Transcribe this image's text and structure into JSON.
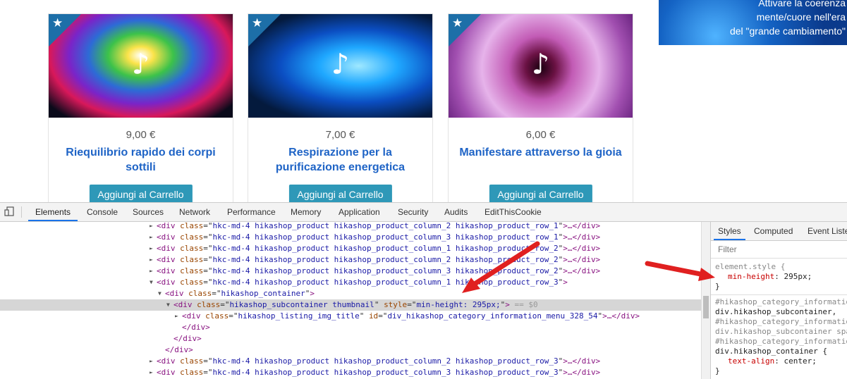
{
  "products": [
    {
      "price": "9,00 €",
      "title": "Riequilibrio rapido dei corpi sottili",
      "button": "Aggiungi al Carrello",
      "icon": "music-note-icon"
    },
    {
      "price": "7,00 €",
      "title": "Respirazione per la purificazione energetica",
      "button": "Aggiungi al Carrello",
      "icon": "music-note-icon"
    },
    {
      "price": "6,00 €",
      "title": "Manifestare attraverso la gioia",
      "button": "Aggiungi al Carrello",
      "icon": "music-note-icon"
    }
  ],
  "banner": {
    "line1": "Attivare la coerenza",
    "line2": "mente/cuore nell'era",
    "line3": "del \"grande cambiamento\""
  },
  "devtools": {
    "tabs": [
      "Elements",
      "Console",
      "Sources",
      "Network",
      "Performance",
      "Memory",
      "Application",
      "Security",
      "Audits",
      "EditThisCookie"
    ],
    "active_tab": "Elements",
    "dom_lines": [
      {
        "indent": 0,
        "tri": "►",
        "html_tag": "div",
        "class": "hkc-md-4 hikashop_product hikashop_product_column_2 hikashop_product_row_1",
        "rest": ">…</div>"
      },
      {
        "indent": 0,
        "tri": "►",
        "html_tag": "div",
        "class": "hkc-md-4 hikashop_product hikashop_product_column_3 hikashop_product_row_1",
        "rest": ">…</div>"
      },
      {
        "indent": 0,
        "tri": "►",
        "html_tag": "div",
        "class": "hkc-md-4 hikashop_product hikashop_product_column_1 hikashop_product_row_2",
        "rest": ">…</div>"
      },
      {
        "indent": 0,
        "tri": "►",
        "html_tag": "div",
        "class": "hkc-md-4 hikashop_product hikashop_product_column_2 hikashop_product_row_2",
        "rest": ">…</div>"
      },
      {
        "indent": 0,
        "tri": "►",
        "html_tag": "div",
        "class": "hkc-md-4 hikashop_product hikashop_product_column_3 hikashop_product_row_2",
        "rest": ">…</div>"
      },
      {
        "indent": 0,
        "tri": "▼",
        "html_tag": "div",
        "class": "hkc-md-4 hikashop_product hikashop_product_column_1 hikashop_product_row_3",
        "rest": ">"
      },
      {
        "indent": 1,
        "tri": "▼",
        "html_tag": "div",
        "class": "hikashop_container",
        "rest": ">"
      },
      {
        "indent": 2,
        "tri": "▼",
        "html_tag": "div",
        "class": "hikashop_subcontainer thumbnail",
        "style": "min-height: 295px;",
        "rest": ">",
        "marker": "== $0",
        "selected": true
      },
      {
        "indent": 3,
        "tri": "►",
        "html_tag": "div",
        "class": "hikashop_listing_img_title",
        "id": "div_hikashop_category_information_menu_328_54",
        "rest": ">…</div>"
      },
      {
        "indent": 3,
        "tri": "",
        "closing": "</div>"
      },
      {
        "indent": 2,
        "tri": "",
        "closing": "</div>"
      },
      {
        "indent": 1,
        "tri": "",
        "closing": "</div>"
      },
      {
        "indent": 0,
        "tri": "►",
        "html_tag": "div",
        "class": "hkc-md-4 hikashop_product hikashop_product_column_2 hikashop_product_row_3",
        "rest": ">…</div>"
      },
      {
        "indent": 0,
        "tri": "►",
        "html_tag": "div",
        "class": "hkc-md-4 hikashop_product hikashop_product_column_3 hikashop_product_row_3",
        "rest": ">…</div>"
      }
    ],
    "styles_tabs": [
      "Styles",
      "Computed",
      "Event Listeners"
    ],
    "filter_placeholder": "Filter",
    "element_style": {
      "selector": "element.style {",
      "prop": "min-height",
      "value": "295px;",
      "close": "}"
    },
    "rule2": {
      "lines": [
        "#hikashop_category_information_",
        "div.hikashop_subcontainer,",
        "#hikashop_category_information_",
        "div.hikashop_subcontainer spa",
        "#hikashop_category_information_",
        "div.hikashop_container {"
      ],
      "prop": "text-align",
      "value": "center;",
      "close": "}"
    }
  },
  "colors": {
    "accent": "#1a73e8",
    "button": "#2e98b8",
    "title": "#1f64c6",
    "arrow": "#e02020"
  }
}
